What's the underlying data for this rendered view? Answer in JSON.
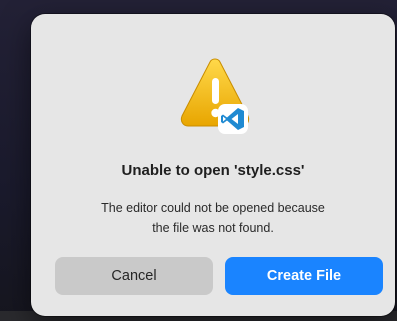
{
  "dialog": {
    "title": "Unable to open 'style.css'",
    "message_line1": "The editor could not be opened because",
    "message_line2": "the file was not found.",
    "icon": "warning-icon",
    "badge_icon": "vscode-icon",
    "cancel_label": "Cancel",
    "create_label": "Create File"
  },
  "colors": {
    "dialog_bg": "#e6e6e6",
    "primary_button": "#1a84ff",
    "secondary_button": "#c9c9c9",
    "warning": "#f5b800",
    "vscode_badge": "#1f8ad2"
  }
}
